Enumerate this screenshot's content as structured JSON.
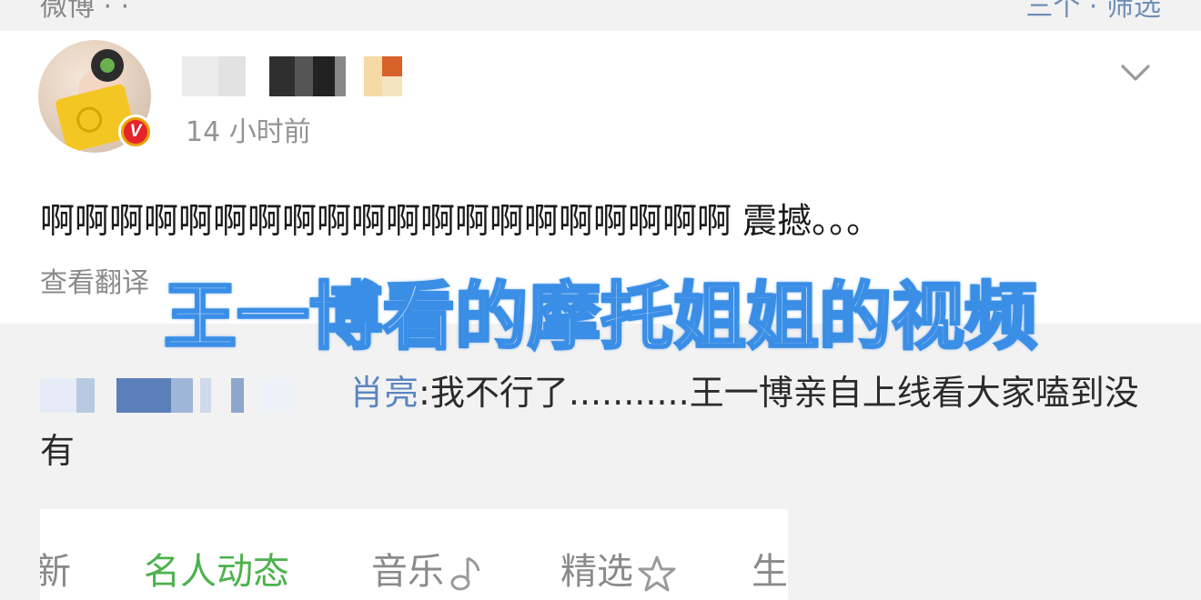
{
  "post": {
    "timestamp": "14 小时前",
    "text": "啊啊啊啊啊啊啊啊啊啊啊啊啊啊啊啊啊啊啊啊 震撼。。。",
    "translate_label": "查看翻译"
  },
  "overlay": {
    "caption": "王一博看的摩托姐姐的视频"
  },
  "comment": {
    "name_tail": "肖亮",
    "text": ":我不行了...........王一博亲自上线看大家嗑到没有"
  },
  "tabs": {
    "items": [
      "新",
      "名人动态",
      "音乐",
      "精选",
      "生"
    ],
    "active_index": 1
  },
  "colors": {
    "accent_green": "#4db24d",
    "link_blue": "#5b86c0",
    "overlay_stroke": "#3a8ee6",
    "verified_red": "#e5242a"
  }
}
